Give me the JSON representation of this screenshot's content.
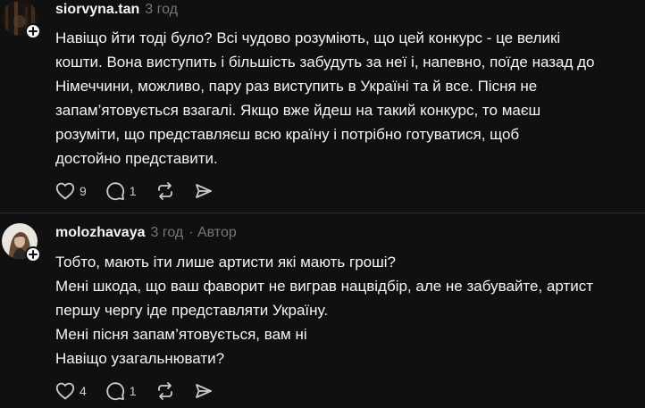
{
  "comments": [
    {
      "username": "siorvyna.tan",
      "time": "3 год",
      "author_tag": "",
      "lines": [
        "Навіщо йти тоді було? Всі чудово розуміють, що цей конкурс - це великі",
        "кошти. Вона виступить і більшість забудуть за неї і, напевно, поїде назад до",
        "Німеччини, можливо, пару раз виступить в Україні та й все. Пісня не",
        "запам’ятовується взагалі. Якщо вже йдеш на такий конкурс, то маєш",
        "розуміти, що представляєш всю країну і потрібно готуватися, щоб",
        "достойно представити."
      ],
      "likes": "9",
      "replies": "1"
    },
    {
      "username": "molozhavaya",
      "time": "3 год",
      "author_tag": "· Автор",
      "lines": [
        "Тобто, мають іти лише артисти які мають гроші?",
        "Мені шкода, що ваш фаворит не виграв нацвідбір, але не забувайте, артист",
        "першу чергу іде представляти Україну.",
        "Мені пісня запам’ятовується, вам ні",
        "Навіщо узагальнювати?"
      ],
      "likes": "4",
      "replies": "1"
    }
  ],
  "icons": {
    "like": "heart-icon",
    "reply": "comment-bubble-icon",
    "repost": "repost-icon",
    "share": "send-icon",
    "follow": "plus-icon"
  },
  "colors": {
    "background": "#101010",
    "text": "#f3f5f7",
    "secondary": "#777777"
  }
}
